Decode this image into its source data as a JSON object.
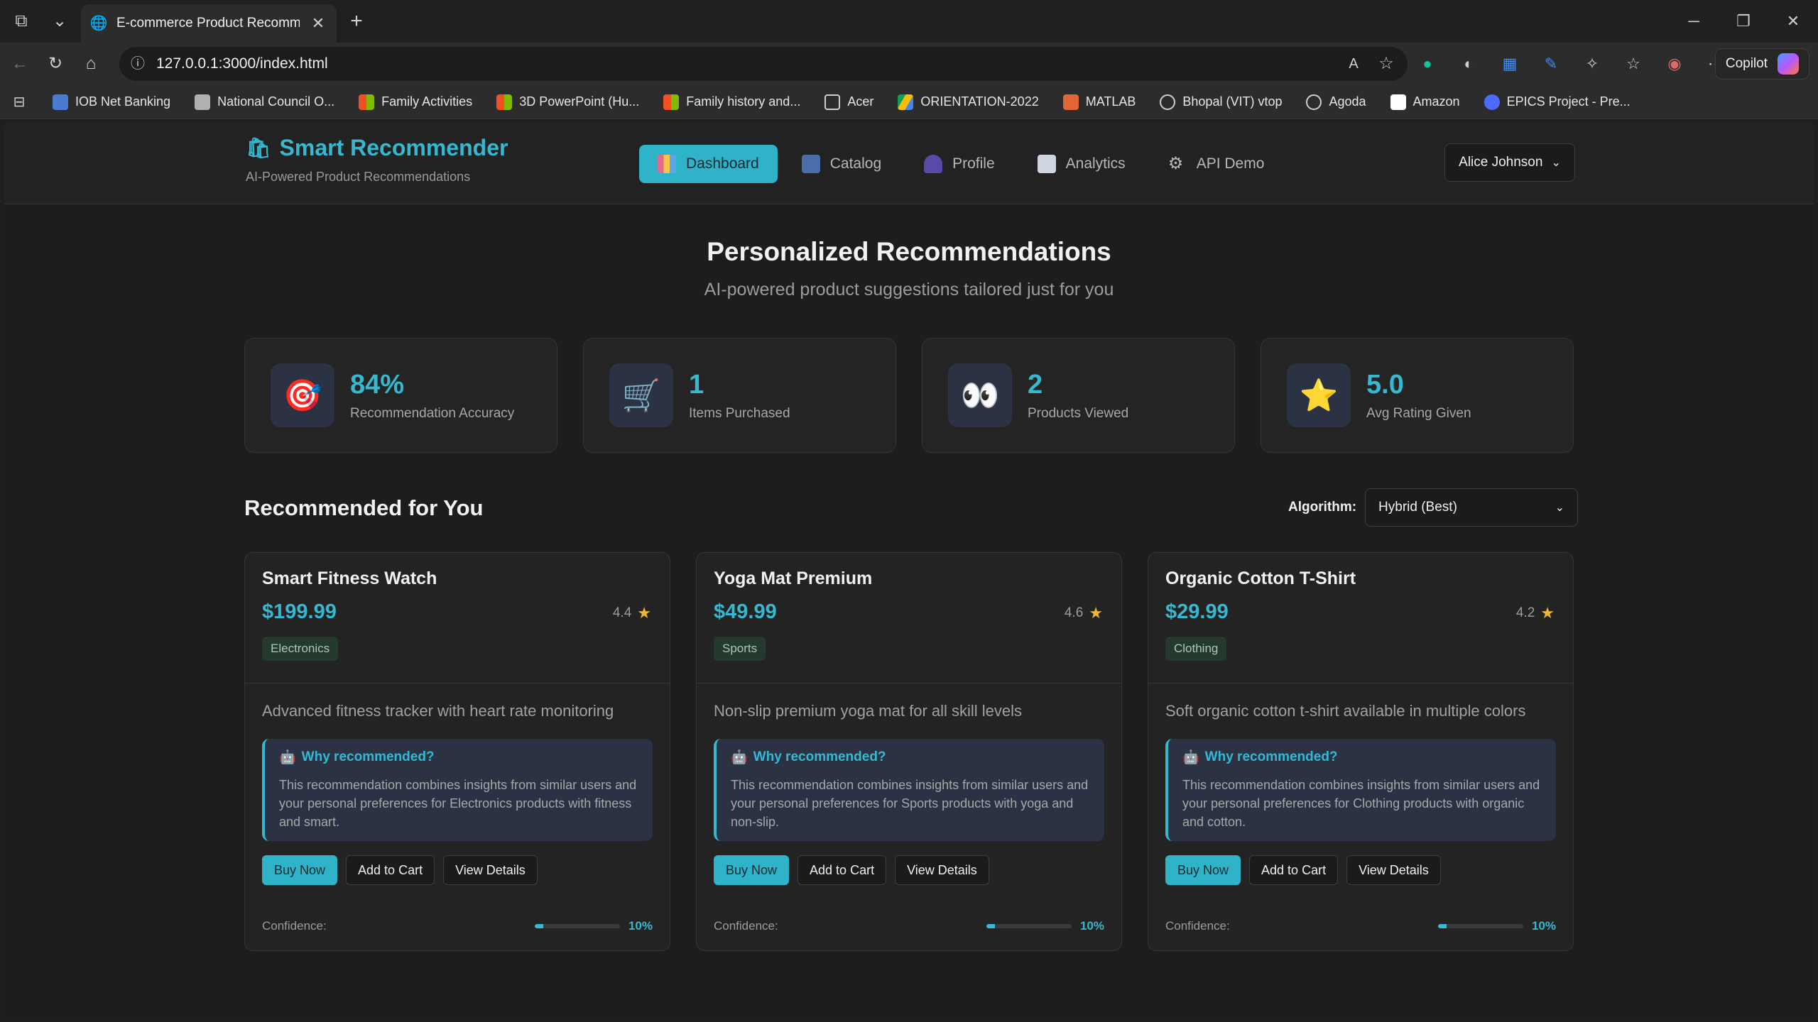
{
  "browser": {
    "tab_title": "E-commerce Product Recommend",
    "url": "127.0.0.1:3000/index.html",
    "copilot_label": "Copilot",
    "bookmarks": [
      {
        "label": "IOB Net Banking",
        "color": "#4a7bd1"
      },
      {
        "label": "National Council O...",
        "color": "#b0b0b0"
      },
      {
        "label": "Family Activities",
        "color": "#f25022"
      },
      {
        "label": "3D PowerPoint (Hu...",
        "color": "#f25022"
      },
      {
        "label": "Family history and...",
        "color": "#f25022"
      },
      {
        "label": "Acer",
        "color": "#cfcfcf"
      },
      {
        "label": "ORIENTATION-2022",
        "color": "#fbbc04"
      },
      {
        "label": "MATLAB",
        "color": "#e16737"
      },
      {
        "label": "Bhopal (VIT) vtop",
        "color": "#cfcfcf"
      },
      {
        "label": "Agoda",
        "color": "#cfcfcf"
      },
      {
        "label": "Amazon",
        "color": "#ffffff"
      },
      {
        "label": "EPICS Project - Pre...",
        "color": "#4d6bfe"
      }
    ]
  },
  "app": {
    "brand": "Smart Recommender",
    "tagline": "AI-Powered Product Recommendations",
    "nav": [
      {
        "label": "Dashboard",
        "icon": "bar-chart-icon",
        "active": true
      },
      {
        "label": "Catalog",
        "icon": "shopping-bags-icon",
        "active": false
      },
      {
        "label": "Profile",
        "icon": "user-icon",
        "active": false
      },
      {
        "label": "Analytics",
        "icon": "line-chart-icon",
        "active": false
      },
      {
        "label": "API Demo",
        "icon": "gear-icon",
        "active": false
      }
    ],
    "user": "Alice Johnson"
  },
  "page": {
    "title": "Personalized Recommendations",
    "subtitle": "AI-powered product suggestions tailored just for you"
  },
  "stats": [
    {
      "value": "84%",
      "label": "Recommendation Accuracy",
      "icon": "target-icon",
      "glyph": "🎯"
    },
    {
      "value": "1",
      "label": "Items Purchased",
      "icon": "cart-icon",
      "glyph": "🛒"
    },
    {
      "value": "2",
      "label": "Products Viewed",
      "icon": "eyes-icon",
      "glyph": "👀"
    },
    {
      "value": "5.0",
      "label": "Avg Rating Given",
      "icon": "star-icon",
      "glyph": "⭐"
    }
  ],
  "recommendations": {
    "title": "Recommended for You",
    "algorithm_label": "Algorithm:",
    "algorithm_value": "Hybrid (Best)",
    "why_title": "Why recommended?",
    "buttons": {
      "buy": "Buy Now",
      "cart": "Add to Cart",
      "details": "View Details"
    },
    "confidence_label": "Confidence:",
    "products": [
      {
        "name": "Smart Fitness Watch",
        "price": "$199.99",
        "rating": "4.4",
        "category": "Electronics",
        "description": "Advanced fitness tracker with heart rate monitoring",
        "why": "This recommendation combines insights from similar users and your personal preferences for Electronics products with fitness and smart.",
        "confidence": "10%",
        "confidence_fraction": 0.1
      },
      {
        "name": "Yoga Mat Premium",
        "price": "$49.99",
        "rating": "4.6",
        "category": "Sports",
        "description": "Non-slip premium yoga mat for all skill levels",
        "why": "This recommendation combines insights from similar users and your personal preferences for Sports products with yoga and non-slip.",
        "confidence": "10%",
        "confidence_fraction": 0.1
      },
      {
        "name": "Organic Cotton T-Shirt",
        "price": "$29.99",
        "rating": "4.2",
        "category": "Clothing",
        "description": "Soft organic cotton t-shirt available in multiple colors",
        "why": "This recommendation combines insights from similar users and your personal preferences for Clothing products with organic and cotton.",
        "confidence": "10%",
        "confidence_fraction": 0.1
      }
    ]
  },
  "colors": {
    "accent": "#35b8d0",
    "star": "#f2b52b"
  }
}
